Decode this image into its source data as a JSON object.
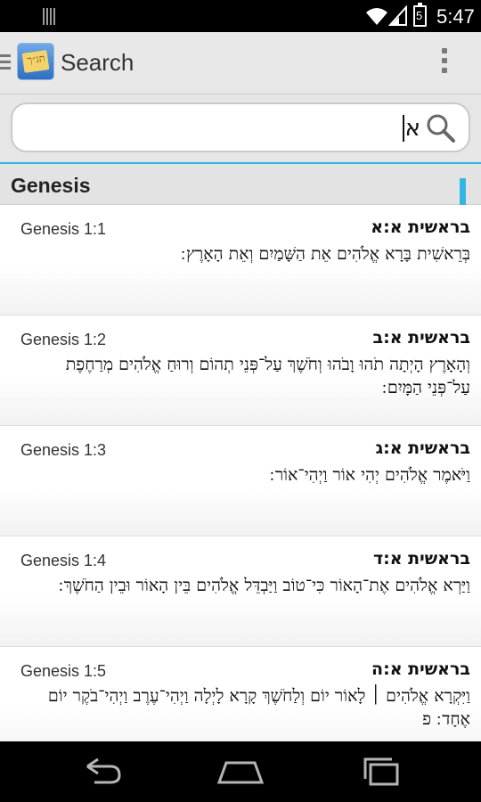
{
  "status_bar": {
    "time": "5:47",
    "battery_level": "5"
  },
  "action_bar": {
    "title": "Search",
    "logo_text": "תנ״ך"
  },
  "search": {
    "value": "א",
    "icon": "search-icon"
  },
  "section": {
    "title": "Genesis"
  },
  "verses": [
    {
      "ref": "Genesis 1:1",
      "heb_ref": "בראשית א:א",
      "text": "בְּרֵאשִׁית בָּרָא אֱלֹהִים אֵת הַשָּׁמַיִם וְאֵת הָאָרֶץ ׃"
    },
    {
      "ref": "Genesis 1:2",
      "heb_ref": "בראשית א:ב",
      "text": "וְהָאָרֶץ הָיְתָה תֹהוּ וָבֹהוּ וְחֹשֶׁךְ עַל־פְּנֵי תְהוֹם וְרוּחַ אֱלֹהִים מְרַחֶפֶת עַל־פְּנֵי הַמָּיִם ׃"
    },
    {
      "ref": "Genesis 1:3",
      "heb_ref": "בראשית א:ג",
      "text": "וַיֹּאמֶר אֱלֹהִים יְהִי אוֹר וַיְהִי־אוֹר ׃"
    },
    {
      "ref": "Genesis 1:4",
      "heb_ref": "בראשית א:ד",
      "text": "וַיַּרְא אֱלֹהִים אֶת־הָאוֹר כִּי־טוֹב וַיַּבְדֵּל אֱלֹהִים בֵּין הָאוֹר וּבֵין הַחֹשֶׁךְ ׃"
    },
    {
      "ref": "Genesis 1:5",
      "heb_ref": "בראשית א:ה",
      "text": "וַיִּקְרָא אֱלֹהִים ׀ לָאוֹר יוֹם וְלַחֹשֶׁךְ קָרָא לָיְלָה וַיְהִי־עֶרֶב וַיְהִי־בֹקֶר יוֹם אֶחָד ׃ פ"
    }
  ],
  "nav": {
    "back": "back-icon",
    "home": "home-icon",
    "recents": "recents-icon"
  }
}
